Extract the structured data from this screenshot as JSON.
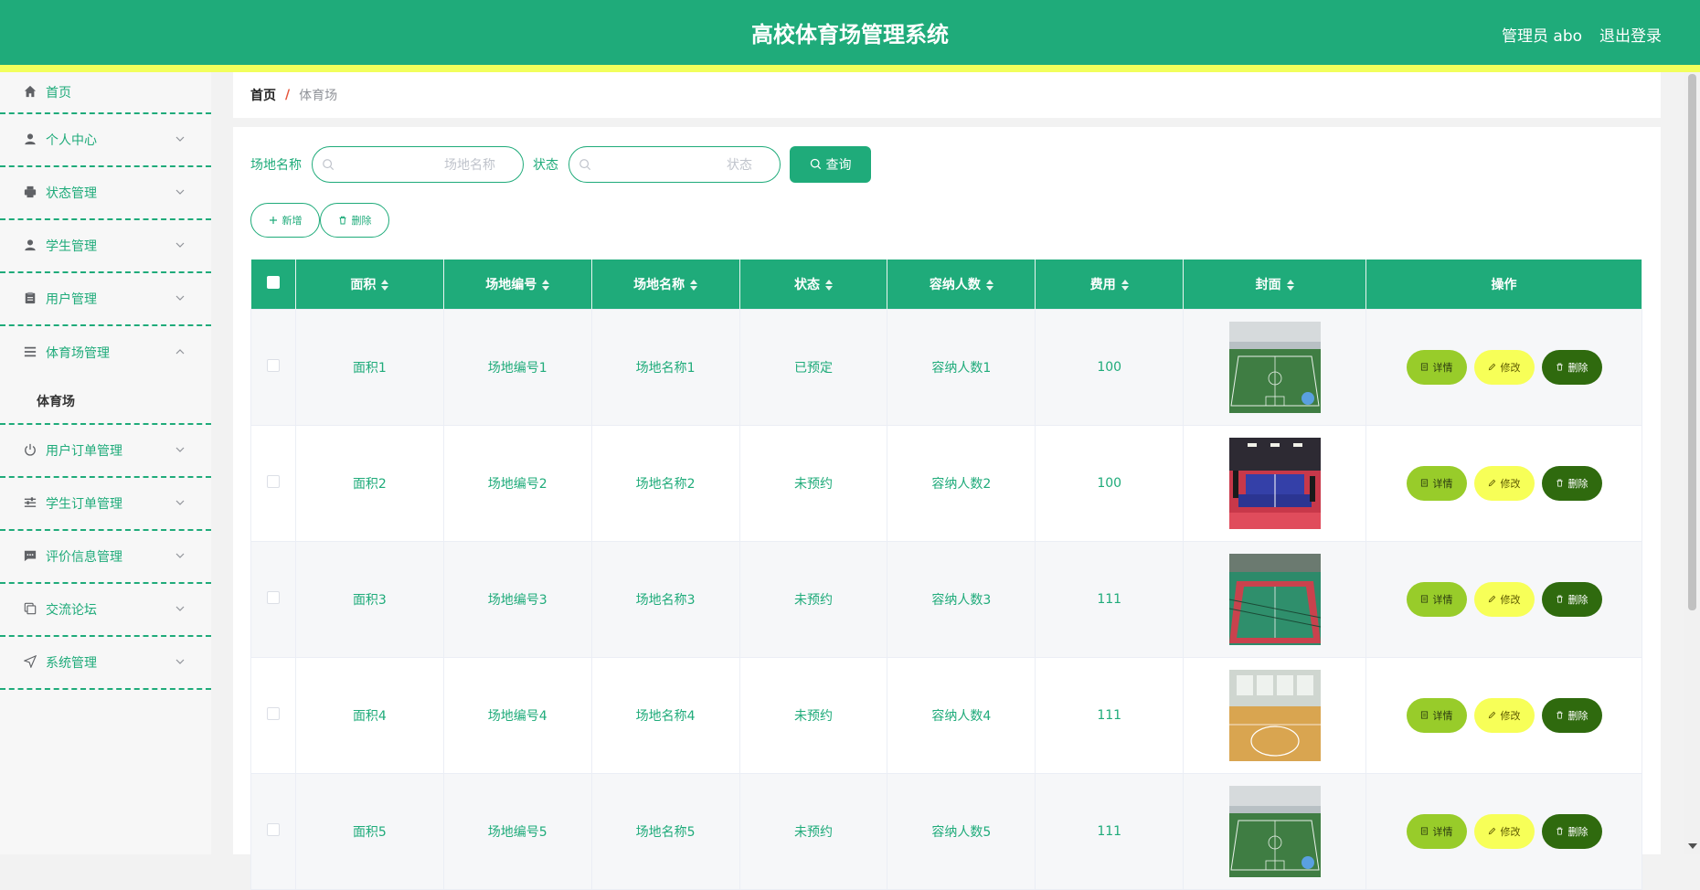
{
  "header": {
    "title": "高校体育场管理系统",
    "user": "管理员 abo",
    "logout": "退出登录",
    "color": "#1fab7a",
    "strip_color": "#f2ff5c"
  },
  "sidebar": {
    "items": [
      {
        "label": "首页",
        "icon": "home-icon"
      },
      {
        "label": "个人中心",
        "icon": "user-icon"
      },
      {
        "label": "状态管理",
        "icon": "printer-icon"
      },
      {
        "label": "学生管理",
        "icon": "user-icon"
      },
      {
        "label": "用户管理",
        "icon": "clipboard-icon"
      },
      {
        "label": "体育场管理",
        "icon": "list-icon",
        "open": true,
        "sub": "体育场"
      },
      {
        "label": "用户订单管理",
        "icon": "power-icon"
      },
      {
        "label": "学生订单管理",
        "icon": "sliders-icon"
      },
      {
        "label": "评价信息管理",
        "icon": "chat-icon"
      },
      {
        "label": "交流论坛",
        "icon": "copy-icon"
      },
      {
        "label": "系统管理",
        "icon": "send-icon"
      }
    ]
  },
  "breadcrumb": {
    "home": "首页",
    "separator": "/",
    "current": "体育场"
  },
  "search": {
    "name_label": "场地名称",
    "name_placeholder": "场地名称",
    "status_label": "状态",
    "status_placeholder": "状态",
    "query_label": "查询"
  },
  "actions": {
    "add": "新增",
    "delete": "删除"
  },
  "table": {
    "columns": [
      "面积",
      "场地编号",
      "场地名称",
      "状态",
      "容纳人数",
      "费用",
      "封面",
      "操作"
    ],
    "rows": [
      {
        "area": "面积1",
        "code": "场地编号1",
        "name": "场地名称1",
        "status": "已预定",
        "capacity": "容纳人数1",
        "fee": "100",
        "cover": "soccer-field-photo"
      },
      {
        "area": "面积2",
        "code": "场地编号2",
        "name": "场地名称2",
        "status": "未预约",
        "capacity": "容纳人数2",
        "fee": "100",
        "cover": "table-tennis-photo"
      },
      {
        "area": "面积3",
        "code": "场地编号3",
        "name": "场地名称3",
        "status": "未预约",
        "capacity": "容纳人数3",
        "fee": "111",
        "cover": "outdoor-court-photo"
      },
      {
        "area": "面积4",
        "code": "场地编号4",
        "name": "场地名称4",
        "status": "未预约",
        "capacity": "容纳人数4",
        "fee": "111",
        "cover": "basketball-court-photo"
      },
      {
        "area": "面积5",
        "code": "场地编号5",
        "name": "场地名称5",
        "status": "未预约",
        "capacity": "容纳人数5",
        "fee": "111",
        "cover": "soccer-field-photo"
      }
    ],
    "op_detail": "详情",
    "op_edit": "修改",
    "op_delete": "删除"
  }
}
